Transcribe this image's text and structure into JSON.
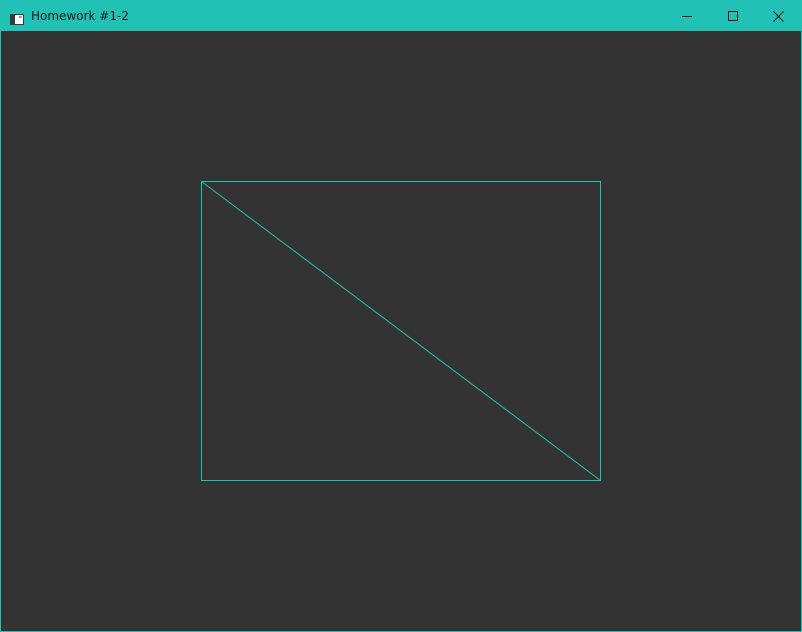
{
  "window": {
    "title": "Homework #1-2",
    "accent_color": "#22c1b5",
    "background_color": "#333333"
  },
  "titlebar": {
    "icon": "app-window-icon",
    "controls": [
      "minimize-icon",
      "maximize-icon",
      "close-icon"
    ]
  },
  "canvas": {
    "shapes": [
      {
        "kind": "rectangle-outline",
        "color": "#22c1b5"
      },
      {
        "kind": "diagonal-line",
        "color": "#22c1b5"
      }
    ]
  }
}
